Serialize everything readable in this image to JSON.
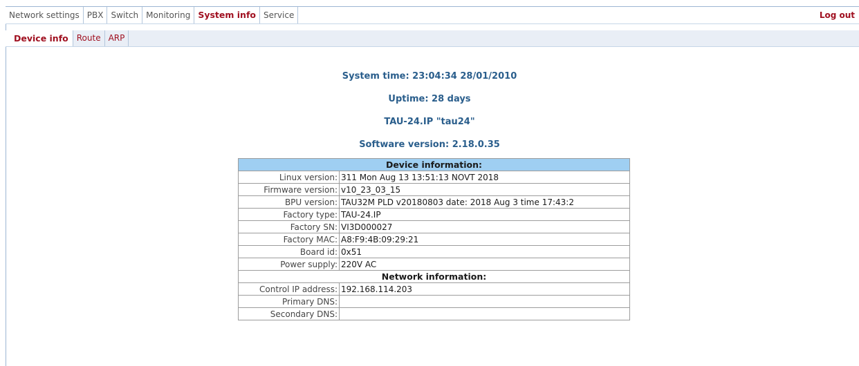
{
  "topnav": {
    "tabs": [
      {
        "label": "Network settings"
      },
      {
        "label": "PBX"
      },
      {
        "label": "Switch"
      },
      {
        "label": "Monitoring"
      },
      {
        "label": "System info"
      },
      {
        "label": "Service"
      }
    ],
    "active": "System info",
    "logout": "Log out"
  },
  "subnav": {
    "tabs": [
      {
        "label": "Device info"
      },
      {
        "label": "Route"
      },
      {
        "label": "ARP"
      }
    ],
    "active": "Device info"
  },
  "summary": {
    "system_time": "System time: 23:04:34  28/01/2010",
    "uptime": "Uptime: 28 days",
    "device_name": "TAU-24.IP \"tau24\"",
    "software_version": "Software version: 2.18.0.35"
  },
  "device_info": {
    "title": "Device information:",
    "rows": [
      {
        "label": "Linux version:",
        "value": "311 Mon Aug 13 13:51:13 NOVT 2018"
      },
      {
        "label": "Firmware version:",
        "value": "v10_23_03_15"
      },
      {
        "label": "BPU version:",
        "value": "TAU32M PLD v20180803 date: 2018 Aug 3 time 17:43:2"
      },
      {
        "label": "Factory type:",
        "value": "TAU-24.IP"
      },
      {
        "label": "Factory SN:",
        "value": "VI3D000027"
      },
      {
        "label": "Factory MAC:",
        "value": "A8:F9:4B:09:29:21"
      },
      {
        "label": "Board id:",
        "value": "0x51"
      },
      {
        "label": "Power supply:",
        "value": "220V AC"
      }
    ]
  },
  "network_info": {
    "title": "Network information:",
    "rows": [
      {
        "label": "Control IP address:",
        "value": "192.168.114.203"
      },
      {
        "label": "Primary DNS:",
        "value": ""
      },
      {
        "label": "Secondary DNS:",
        "value": ""
      }
    ]
  }
}
